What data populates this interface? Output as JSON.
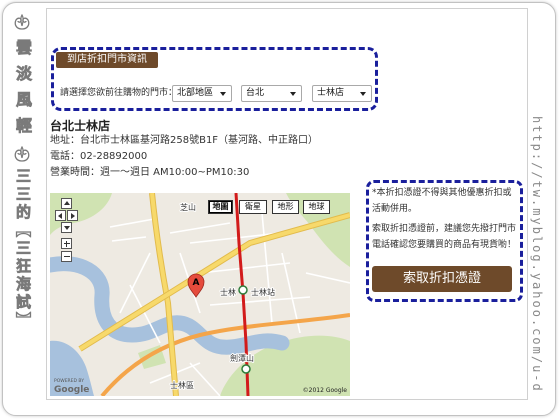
{
  "blog": {
    "title": "雲淡風輕",
    "subtitle": "三三的【三狂海試】",
    "url": "http://tw.myblog.yahoo.com/u-d",
    "ornament_icon": "ornament-swirl-icon"
  },
  "store_selector": {
    "label": "到店折扣門市資訊",
    "prompt": "請選擇您欲前往購物的門市：",
    "region": "北部地區",
    "city": "台北",
    "store": "士林店",
    "dropdown_icon": "dropdown-arrow-icon"
  },
  "store": {
    "name": "台北士林店",
    "address": "地址：台北市士林區基河路258號B1F（基河路、中正路口）",
    "phone": "電話：02-28892000",
    "hours": "營業時間：週一～週日 AM10:00~PM10:30"
  },
  "map": {
    "types": [
      "地圖",
      "衛星",
      "地形",
      "地球"
    ],
    "active_type_index": 0,
    "marker_label": "A",
    "place_labels": {
      "zhishan": "芝山",
      "shilin": "士林",
      "shilin_station": "士林站",
      "jiantanshan": "劍潭山",
      "shilin_district": "士林區"
    },
    "powered_by": "POWERED BY",
    "logo": "Google",
    "copyright": "©2012 Google",
    "controls": [
      "pan-up-icon",
      "pan-left-icon",
      "pan-right-icon",
      "pan-down-icon",
      "zoom-in-icon",
      "zoom-out-icon"
    ]
  },
  "coupon": {
    "note": "*本折扣憑證不得與其他優惠折扣或活動併用。",
    "advice": "索取折扣憑證前，建議您先撥打門市電話確認您要購買的商品有現貨喲！",
    "button_label": "索取折扣憑證"
  },
  "colors": {
    "brand_brown": "#6e4a2a",
    "dashed_border": "#1a1f9c",
    "text": "#333333",
    "map_land": "#eeeae2",
    "map_water": "#a7c1dd",
    "map_park": "#d0e3b2",
    "map_road": "#f7d96b",
    "map_highway": "#f4a54a",
    "mrt_line": "#d21b1b",
    "marker": "#e54b3c"
  }
}
